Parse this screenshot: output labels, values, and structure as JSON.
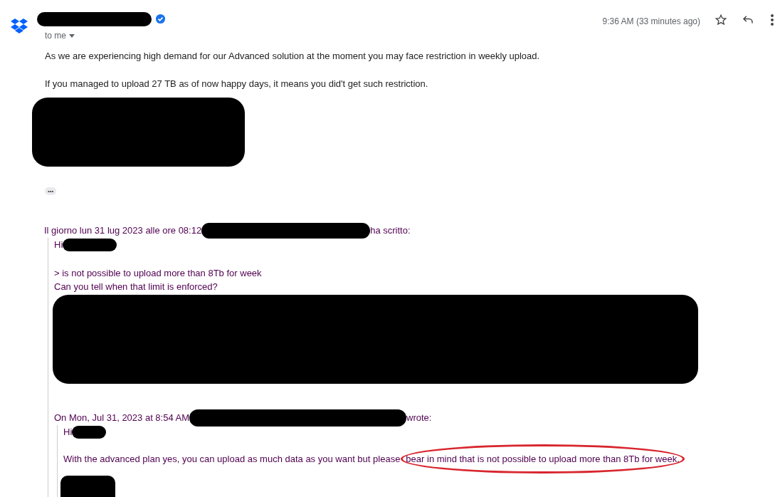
{
  "sender": {
    "verified": true
  },
  "recipient": "to me",
  "time": "9:36 AM (33 minutes ago)",
  "body": [
    "As we are experiencing high demand for our Advanced solution at the moment you may face restriction in weekly upload.",
    "If you managed to upload 27 TB as of now happy days, it means you did't get such restriction."
  ],
  "show_trimmed": "•••",
  "quote": {
    "intro": "Il giorno lun 31 lug 2023 alle ore 08:12",
    "intro_end": "ha scritto:",
    "greeting": "Hi",
    "lines": [
      "> is not possible to upload more than 8Tb for week",
      "Can you tell when that limit is enforced?"
    ],
    "quote": {
      "intro": "On Mon, Jul 31, 2023 at 8:54 AM",
      "intro_end": "wrote:",
      "greeting": "Hi",
      "text": "With the advanced plan yes, you can upload as much data as you want but please",
      "highlight": "bear in mind that is not possible to upload more than 8Tb for week."
    }
  }
}
